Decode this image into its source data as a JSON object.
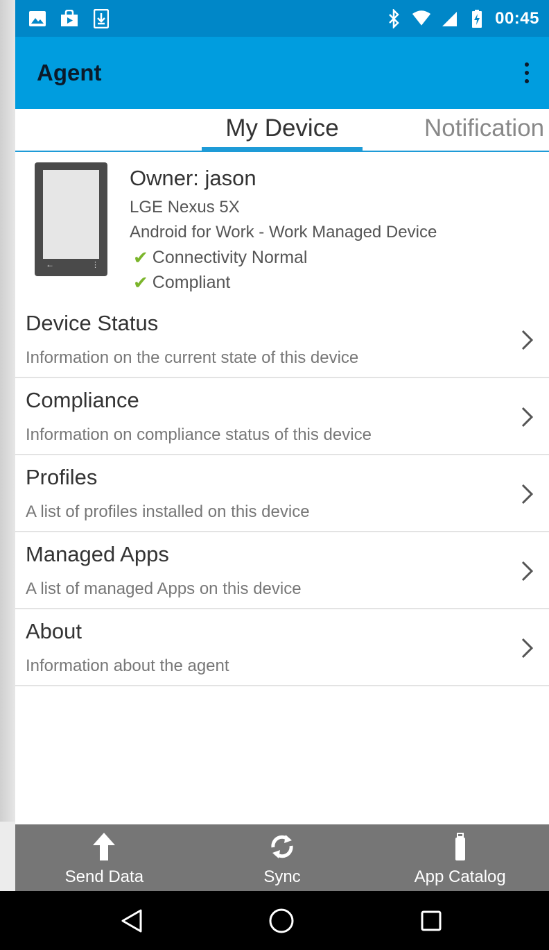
{
  "status_bar": {
    "time": "00:45",
    "left_icons": [
      "image-icon",
      "play-store-icon",
      "download-icon"
    ],
    "right_icons": [
      "bluetooth-icon",
      "wifi-icon",
      "signal-icon",
      "battery-charging-icon"
    ]
  },
  "app_bar": {
    "title": "Agent",
    "menu_icon": "overflow-menu-icon"
  },
  "tabs": [
    {
      "label": "My Device",
      "active": true
    },
    {
      "label": "Notification",
      "active": false
    }
  ],
  "device": {
    "owner": "Owner: jason",
    "model": "LGE Nexus 5X",
    "management": "Android for Work - Work Managed Device",
    "checks": [
      {
        "label": "Connectivity Normal",
        "icon": "checkmark-icon"
      },
      {
        "label": "Compliant",
        "icon": "checkmark-icon"
      }
    ]
  },
  "menu": [
    {
      "title": "Device Status",
      "desc": "Information on the current state of this device"
    },
    {
      "title": "Compliance",
      "desc": "Information on compliance status of this device"
    },
    {
      "title": "Profiles",
      "desc": "A list of profiles installed on this device"
    },
    {
      "title": "Managed Apps",
      "desc": "A list of managed Apps on this device"
    },
    {
      "title": "About",
      "desc": "Information about the agent"
    }
  ],
  "actions": [
    {
      "label": "Send Data",
      "icon": "upload-arrow-icon"
    },
    {
      "label": "Sync",
      "icon": "sync-icon"
    },
    {
      "label": "App Catalog",
      "icon": "app-catalog-icon"
    }
  ],
  "nav": [
    "back-icon",
    "home-icon",
    "recents-icon"
  ],
  "colors": {
    "status_bar": "#0087c8",
    "app_bar": "#009ddf",
    "accent": "#1e9bd7",
    "check": "#7bb52b",
    "action_bar": "#767676"
  }
}
